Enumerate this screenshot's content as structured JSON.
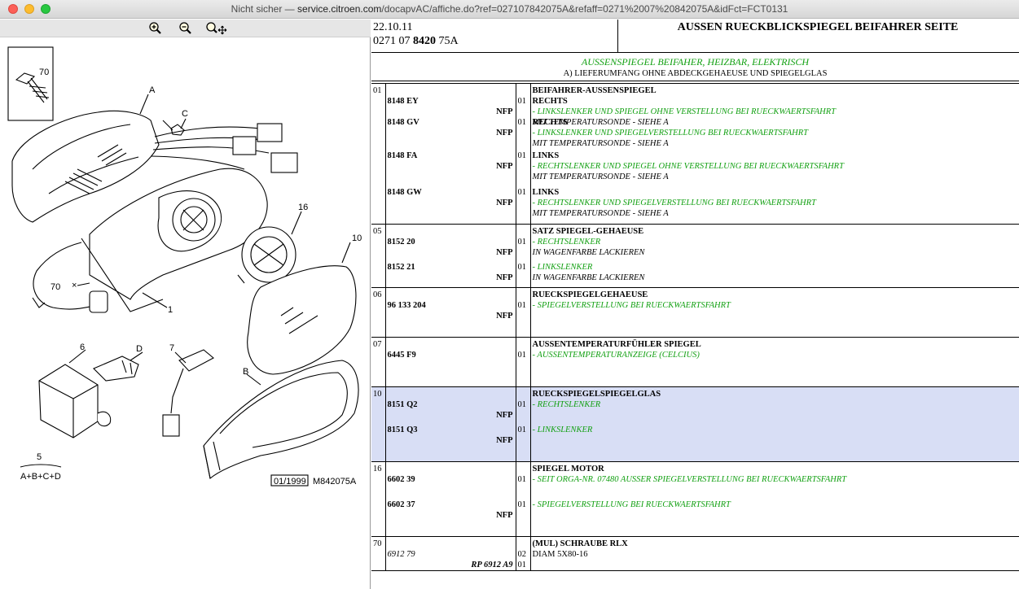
{
  "window": {
    "title_prefix": "Nicht sicher —",
    "host": "service.citroen.com",
    "path": "/docapvAC/affiche.do?ref=027107842075A&refaff=0271%2007%20842075A&idFct=FCT0131"
  },
  "zoom": {
    "icons": [
      "zoom-in-icon",
      "zoom-out-icon",
      "zoom-pan-icon"
    ]
  },
  "diagram": {
    "labels": {
      "a": "A",
      "b": "B",
      "c": "C",
      "d": "D",
      "n70_box": "70",
      "n70": "70",
      "x_mark": "×",
      "n1": "1",
      "n5": "5",
      "n6": "6",
      "n7": "7",
      "n10": "10",
      "n16": "16",
      "formula": "A+B+C+D",
      "date": "01/1999",
      "code": "M842075A"
    }
  },
  "header": {
    "date": "22.10.11",
    "ref_a": "0271 07",
    "ref_b": "8420",
    "ref_c": "75A",
    "title": "AUSSEN RUECKBLICKSPIEGEL BEIFAHRER SEITE",
    "subtitle": "AUSSENSPIEGEL BEIFAHER, HEIZBAR, ELEKTRISCH",
    "scope": "A) LIEFERUMFANG OHNE ABDECKGEHAEUSE UND SPIEGELGLAS"
  },
  "groups": [
    {
      "pos": "01",
      "title": "BEIFAHRER-AUSSENSPIEGEL",
      "highlight": false,
      "items": [
        {
          "ref": "8148 EY",
          "nfp": "NFP",
          "qty": "01",
          "sub": "RECHTS",
          "green": "- LINKSLENKER UND SPIEGEL OHNE VERSTELLUNG BEI RUECKWAERTSFAHRT",
          "note": "MIT TEMPERATURSONDE - SIEHE A"
        },
        {
          "ref": "8148 GV",
          "nfp": "NFP",
          "qty": "01",
          "sub": "RECHTS",
          "green": "- LINKSLENKER UND SPIEGELVERSTELLUNG BEI RUECKWAERTSFAHRT",
          "note": "MIT TEMPERATURSONDE - SIEHE A"
        },
        {
          "ref": "8148 FA",
          "nfp": "NFP",
          "qty": "01",
          "sub": "LINKS",
          "green": "- RECHTSLENKER UND SPIEGEL OHNE VERSTELLUNG BEI RUECKWAERTSFAHRT",
          "note": "MIT TEMPERATURSONDE - SIEHE A"
        },
        {
          "ref": "8148 GW",
          "nfp": "NFP",
          "qty": "01",
          "sub": "LINKS",
          "green": "- RECHTSLENKER UND SPIEGELVERSTELLUNG BEI RUECKWAERTSFAHRT",
          "note": "MIT TEMPERATURSONDE - SIEHE A"
        }
      ]
    },
    {
      "pos": "05",
      "title": "SATZ SPIEGEL-GEHAEUSE",
      "highlight": false,
      "items": [
        {
          "ref": "8152 20",
          "nfp": "NFP",
          "qty": "01",
          "sub": "",
          "green": "- RECHTSLENKER",
          "note": "IN WAGENFARBE LACKIEREN"
        },
        {
          "ref": "8152 21",
          "nfp": "NFP",
          "qty": "01",
          "sub": "",
          "green": "- LINKSLENKER",
          "note": "IN WAGENFARBE LACKIEREN"
        }
      ]
    },
    {
      "pos": "06",
      "title": "RUECKSPIEGELGEHAEUSE",
      "highlight": false,
      "items": [
        {
          "ref": "96 133 204",
          "nfp": "NFP",
          "qty": "01",
          "sub": "",
          "green": "- SPIEGELVERSTELLUNG BEI RUECKWAERTSFAHRT",
          "note": ""
        }
      ]
    },
    {
      "pos": "07",
      "title": "AUSSENTEMPERATURFÜHLER SPIEGEL",
      "highlight": false,
      "items": [
        {
          "ref": "6445 F9",
          "nfp": "",
          "qty": "01",
          "sub": "",
          "green": "- AUSSENTEMPERATURANZEIGE (CELCIUS)",
          "note": ""
        }
      ]
    },
    {
      "pos": "10",
      "title": "RUECKSPIEGELSPIEGELGLAS",
      "highlight": true,
      "items": [
        {
          "ref": "8151 Q2",
          "nfp": "NFP",
          "qty": "01",
          "sub": "",
          "green": "- RECHTSLENKER",
          "note": ""
        },
        {
          "ref": "8151 Q3",
          "nfp": "NFP",
          "qty": "01",
          "sub": "",
          "green": "- LINKSLENKER",
          "note": ""
        }
      ]
    },
    {
      "pos": "16",
      "title": "SPIEGEL MOTOR",
      "highlight": false,
      "items": [
        {
          "ref": "6602 39",
          "nfp": "",
          "qty": "01",
          "sub": "",
          "green": "- SEIT ORGA-NR. 07480 AUSSER SPIEGELVERSTELLUNG BEI RUECKWAERTSFAHRT",
          "note": ""
        },
        {
          "ref": "6602 37",
          "nfp": "NFP",
          "qty": "01",
          "sub": "",
          "green": "- SPIEGELVERSTELLUNG BEI RUECKWAERTSFAHRT",
          "note": ""
        }
      ]
    },
    {
      "pos": "70",
      "title": "(MUL) SCHRAUBE RLX",
      "highlight": false,
      "items": [
        {
          "ref": "6912 79",
          "ref_italic": true,
          "nfp": "",
          "qty": "02",
          "sub": "",
          "green": "",
          "note": "DIAM 5X80-16",
          "note_plain": true
        },
        {
          "ref": "",
          "nfp": "RP 6912 A9",
          "nfp_italic": true,
          "qty": "01",
          "sub": "",
          "green": "",
          "note": ""
        }
      ]
    }
  ]
}
